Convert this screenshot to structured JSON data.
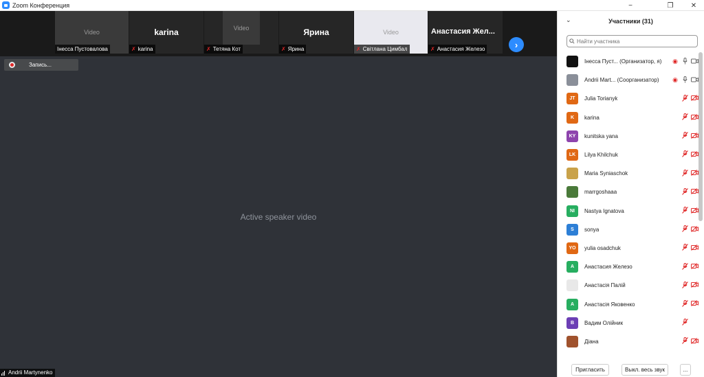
{
  "window": {
    "title": "Zoom Конференция",
    "minimize": "−",
    "maximize": "❐",
    "close": "✕"
  },
  "gallery": [
    {
      "name": "Інесса Пустовалова",
      "video": true,
      "muted": false,
      "placeholder": "Video"
    },
    {
      "name": "karina",
      "video": false,
      "muted": true,
      "display_name": "karina"
    },
    {
      "name": "Тетяна Кот",
      "video": true,
      "muted": true,
      "placeholder": "Video"
    },
    {
      "name": "Ярина",
      "video": false,
      "muted": true,
      "display_name": "Ярина"
    },
    {
      "name": "Світлана Цимбал",
      "video": true,
      "muted": true,
      "placeholder": "Video"
    },
    {
      "name": "Анастасия Железо",
      "video": false,
      "muted": true,
      "display_name": "Анастасия  Жел..."
    }
  ],
  "gallery_next": "›",
  "recording": {
    "label": "Запись..."
  },
  "speaker": {
    "name": "Andrii Martynenko",
    "placeholder": "Active speaker video"
  },
  "panel": {
    "title": "Участники (31)",
    "collapse": "⌄",
    "search_placeholder": "Найти участника",
    "participants": [
      {
        "initials": "",
        "name": "Інесса Пуст... (Организатор, я)",
        "color": "#111111",
        "mic": "on",
        "cam": "on",
        "rec": true
      },
      {
        "initials": "",
        "name": "Andrii Mart... (Соорганизатор)",
        "color": "#8a8f99",
        "mic": "on",
        "cam": "on",
        "rec": true
      },
      {
        "initials": "JT",
        "name": "Julia Torianyk",
        "color": "#e06814",
        "mic": "off",
        "cam": "off"
      },
      {
        "initials": "K",
        "name": "karina",
        "color": "#e06814",
        "mic": "off",
        "cam": "off"
      },
      {
        "initials": "KY",
        "name": "kunitska yana",
        "color": "#8e44ad",
        "mic": "off",
        "cam": "off"
      },
      {
        "initials": "LK",
        "name": "Lilya Khilchuk",
        "color": "#e06814",
        "mic": "off",
        "cam": "off"
      },
      {
        "initials": "",
        "name": "Maria Syniaschok",
        "color": "#c9a24a",
        "mic": "off",
        "cam": "off"
      },
      {
        "initials": "",
        "name": "marrgoshaaa",
        "color": "#4a7a3a",
        "mic": "off",
        "cam": "off"
      },
      {
        "initials": "NI",
        "name": "Nastya Ignatova",
        "color": "#27ae60",
        "mic": "off",
        "cam": "off"
      },
      {
        "initials": "S",
        "name": "sonya",
        "color": "#2d7fd6",
        "mic": "off",
        "cam": "off"
      },
      {
        "initials": "YO",
        "name": "yulia osadchuk",
        "color": "#e06814",
        "mic": "off",
        "cam": "off"
      },
      {
        "initials": "A",
        "name": "Анастасия Железо",
        "color": "#27ae60",
        "mic": "off",
        "cam": "off"
      },
      {
        "initials": "",
        "name": "Анастасія Палій",
        "color": "#e8e8e8",
        "mic": "off",
        "cam": "off"
      },
      {
        "initials": "A",
        "name": "Анастасія Яковенко",
        "color": "#27ae60",
        "mic": "off",
        "cam": "off"
      },
      {
        "initials": "B",
        "name": "Вадим Олійник",
        "color": "#6c3fb5",
        "mic": "off",
        "cam": "none"
      },
      {
        "initials": "",
        "name": "Діана",
        "color": "#a0522d",
        "mic": "off",
        "cam": "off"
      }
    ],
    "invite": "Пригласить",
    "mute_all": "Выкл. весь звук",
    "more": "..."
  },
  "colors": {
    "accent": "#2d8cff",
    "muted_red": "#e02828"
  }
}
